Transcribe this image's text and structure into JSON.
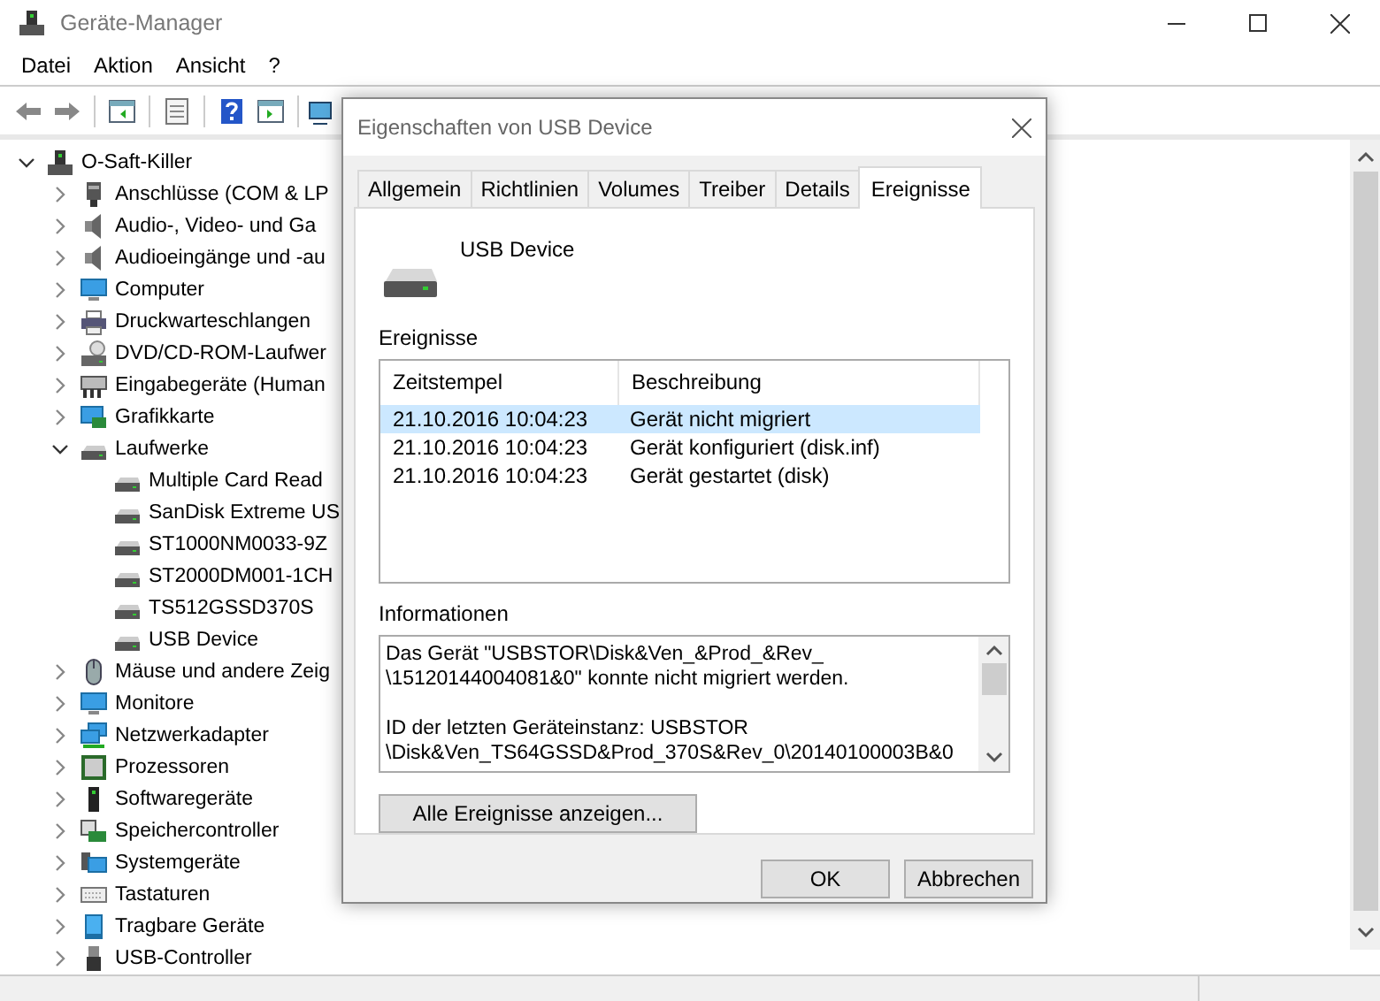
{
  "window": {
    "title": "Geräte-Manager"
  },
  "menu": [
    "Datei",
    "Aktion",
    "Ansicht",
    "?"
  ],
  "toolbar": [
    {
      "kind": "back"
    },
    {
      "kind": "forward"
    },
    {
      "kind": "sep"
    },
    {
      "kind": "pane"
    },
    {
      "kind": "sep"
    },
    {
      "kind": "props"
    },
    {
      "kind": "sep"
    },
    {
      "kind": "help"
    },
    {
      "kind": "pane2"
    },
    {
      "kind": "sep"
    },
    {
      "kind": "scan"
    }
  ],
  "tree": [
    {
      "label": "O-Saft-Killer",
      "kind": "pc",
      "expanded": true,
      "children": [
        {
          "label": "Anschlüsse (COM & LP",
          "kind": "port",
          "expanded": false
        },
        {
          "label": "Audio-, Video- und Ga",
          "kind": "audio",
          "expanded": false
        },
        {
          "label": "Audioeingänge und -au",
          "kind": "audio",
          "expanded": false
        },
        {
          "label": "Computer",
          "kind": "monitor",
          "expanded": false
        },
        {
          "label": "Druckwarteschlangen",
          "kind": "printer",
          "expanded": false
        },
        {
          "label": "DVD/CD-ROM-Laufwer",
          "kind": "disc",
          "expanded": false
        },
        {
          "label": "Eingabegeräte (Human",
          "kind": "input",
          "expanded": false
        },
        {
          "label": "Grafikkarte",
          "kind": "display",
          "expanded": false
        },
        {
          "label": "Laufwerke",
          "kind": "drive",
          "expanded": true,
          "children": [
            {
              "label": "Multiple Card  Read",
              "kind": "drive"
            },
            {
              "label": "SanDisk Extreme US",
              "kind": "drive"
            },
            {
              "label": "ST1000NM0033-9Z",
              "kind": "drive"
            },
            {
              "label": "ST2000DM001-1CH",
              "kind": "drive"
            },
            {
              "label": "TS512GSSD370S",
              "kind": "drive"
            },
            {
              "label": "USB Device",
              "kind": "drive"
            }
          ]
        },
        {
          "label": "Mäuse und andere Zeig",
          "kind": "mouse",
          "expanded": false
        },
        {
          "label": "Monitore",
          "kind": "monitor",
          "expanded": false
        },
        {
          "label": "Netzwerkadapter",
          "kind": "network",
          "expanded": false
        },
        {
          "label": "Prozessoren",
          "kind": "cpu",
          "expanded": false
        },
        {
          "label": "Softwaregeräte",
          "kind": "software",
          "expanded": false
        },
        {
          "label": "Speichercontroller",
          "kind": "storage",
          "expanded": false
        },
        {
          "label": "Systemgeräte",
          "kind": "system",
          "expanded": false
        },
        {
          "label": "Tastaturen",
          "kind": "keyboard",
          "expanded": false
        },
        {
          "label": "Tragbare Geräte",
          "kind": "portable",
          "expanded": false
        },
        {
          "label": "USB-Controller",
          "kind": "usb",
          "expanded": false
        }
      ]
    }
  ],
  "dialog": {
    "title": "Eigenschaften von USB Device",
    "tabs": [
      {
        "label": "Allgemein",
        "selected": false
      },
      {
        "label": "Richtlinien",
        "selected": false
      },
      {
        "label": "Volumes",
        "selected": false
      },
      {
        "label": "Treiber",
        "selected": false
      },
      {
        "label": "Details",
        "selected": false
      },
      {
        "label": "Ereignisse",
        "selected": true
      }
    ],
    "device_name": "USB Device",
    "events_label": "Ereignisse",
    "events": {
      "columns": [
        "Zeitstempel",
        "Beschreibung"
      ],
      "rows": [
        {
          "cells": [
            "21.10.2016 10:04:23",
            "Gerät nicht migriert"
          ],
          "selected": true
        },
        {
          "cells": [
            "21.10.2016 10:04:23",
            "Gerät konfiguriert (disk.inf)"
          ],
          "selected": false
        },
        {
          "cells": [
            "21.10.2016 10:04:23",
            "Gerät gestartet (disk)"
          ],
          "selected": false
        }
      ]
    },
    "info_label": "Informationen",
    "info": [
      "Das Gerät \"USBSTOR\\Disk&Ven_&Prod_&Rev_\n\\15120144004081&0\" konnte nicht migriert werden.",
      "ID der letzten Geräteinstanz: USBSTOR\n\\Disk&Ven_TS64GSSD&Prod_370S&Rev_0\\20140100003B&0"
    ],
    "all_events_button": "Alle Ereignisse anzeigen...",
    "buttons": [
      "OK",
      "Abbrechen"
    ]
  }
}
